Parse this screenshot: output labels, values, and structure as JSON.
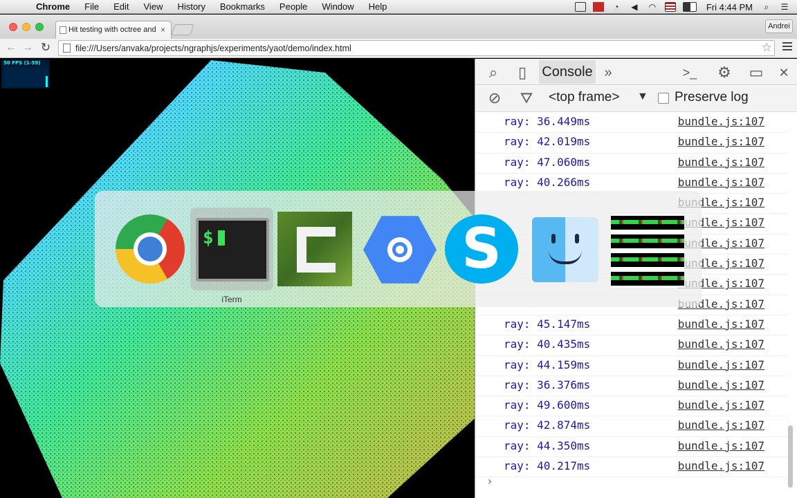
{
  "menubar": {
    "app_name": "Chrome",
    "items": [
      "File",
      "Edit",
      "View",
      "History",
      "Bookmarks",
      "People",
      "Window",
      "Help"
    ],
    "clock": "Fri 4:44 PM"
  },
  "browser": {
    "tab_title": "Hit testing with octree and",
    "profile": "Andrei",
    "url": "file:///Users/anvaka/projects/ngraphjs/experiments/yaot/demo/index.html"
  },
  "viewport": {
    "fps_label": "50 FPS (1-59)"
  },
  "devtools": {
    "active_tab": "Console",
    "frame_selector": "<top frame>",
    "preserve_log_label": "Preserve log",
    "preserve_log_checked": false,
    "log_rows": [
      {
        "msg": "ray: 36.449ms",
        "src": "bundle.js:107"
      },
      {
        "msg": "ray: 42.019ms",
        "src": "bundle.js:107"
      },
      {
        "msg": "ray: 47.060ms",
        "src": "bundle.js:107"
      },
      {
        "msg": "ray: 40.266ms",
        "src": "bundle.js:107"
      },
      {
        "msg": "",
        "src": "bundle.js:107"
      },
      {
        "msg": "",
        "src": "bundle.js:107"
      },
      {
        "msg": "",
        "src": "bundle.js:107"
      },
      {
        "msg": "",
        "src": "bundle.js:107"
      },
      {
        "msg": "",
        "src": "bundle.js:107"
      },
      {
        "msg": "",
        "src": "bundle.js:107"
      },
      {
        "msg": "ray: 45.147ms",
        "src": "bundle.js:107"
      },
      {
        "msg": "ray: 40.435ms",
        "src": "bundle.js:107"
      },
      {
        "msg": "ray: 44.159ms",
        "src": "bundle.js:107"
      },
      {
        "msg": "ray: 36.376ms",
        "src": "bundle.js:107"
      },
      {
        "msg": "ray: 49.600ms",
        "src": "bundle.js:107"
      },
      {
        "msg": "ray: 42.874ms",
        "src": "bundle.js:107"
      },
      {
        "msg": "ray: 44.350ms",
        "src": "bundle.js:107"
      },
      {
        "msg": "ray: 40.217ms",
        "src": "bundle.js:107"
      }
    ],
    "prompt": "›"
  },
  "app_switcher": {
    "selected_label": "iTerm",
    "apps": [
      "chrome-icon",
      "iterm-icon",
      "camtasia-icon",
      "app-engine-launcher-icon",
      "skype-icon",
      "finder-icon",
      "activity-monitor-icon"
    ]
  }
}
